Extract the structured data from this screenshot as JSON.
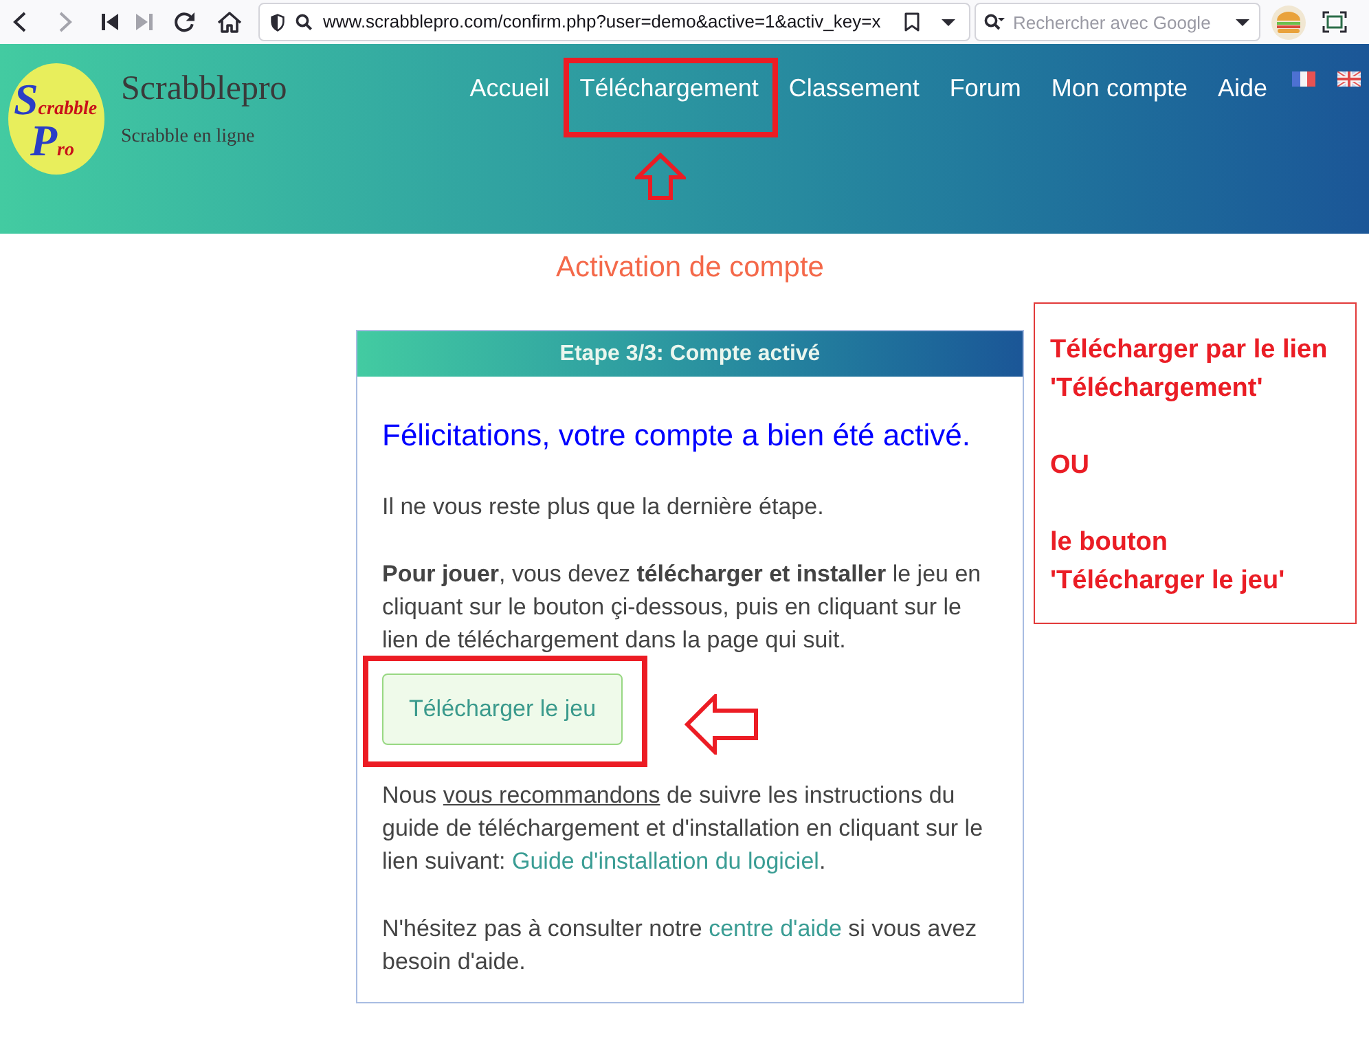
{
  "browser": {
    "nav_buttons": [
      {
        "kind": "back",
        "disabled": false
      },
      {
        "kind": "forward",
        "disabled": true
      },
      {
        "kind": "first",
        "disabled": false
      },
      {
        "kind": "last",
        "disabled": true
      },
      {
        "kind": "reload",
        "disabled": false
      },
      {
        "kind": "home",
        "disabled": false
      }
    ],
    "url": "www.scrabblepro.com/confirm.php?user=demo&active=1&activ_key=x",
    "search_placeholder": "Rechercher avec Google"
  },
  "header": {
    "logo": {
      "lines": [
        {
          "initial": "S",
          "rest": "crabble"
        },
        {
          "initial": "P",
          "rest": "ro"
        }
      ]
    },
    "title": "Scrabblepro",
    "tagline": "Scrabble en ligne",
    "nav": [
      {
        "label": "Accueil",
        "annotated": false
      },
      {
        "label": "Téléchargement",
        "annotated": true
      },
      {
        "label": "Classement",
        "annotated": false
      },
      {
        "label": "Forum",
        "annotated": false
      },
      {
        "label": "Mon compte",
        "annotated": false
      },
      {
        "label": "Aide",
        "annotated": false
      }
    ],
    "languages": [
      {
        "kind": "fr"
      },
      {
        "kind": "en"
      }
    ]
  },
  "page_title": "Activation de compte",
  "card": {
    "header": "Etape 3/3: Compte activé",
    "heading": "Félicitations, votre compte a bien été activé.",
    "blocks": [
      {
        "kind": "paragraph",
        "segments": [
          {
            "kind": "text",
            "text": "Il ne vous reste plus que la dernière étape."
          }
        ]
      },
      {
        "kind": "paragraph",
        "segments": [
          {
            "kind": "text",
            "text": "**Pour jouer**, vous devez **télécharger et installer** le jeu en cliquant sur le bouton çi-dessous, puis en cliquant sur le lien de téléchargement dans la page qui suit."
          }
        ]
      },
      {
        "kind": "button",
        "label": "Télécharger le jeu",
        "annotated": true
      },
      {
        "kind": "paragraph",
        "segments": [
          {
            "kind": "text",
            "text": "Nous "
          },
          {
            "kind": "underline",
            "text": "vous recommandons"
          },
          {
            "kind": "text",
            "text": " de suivre les instructions du guide de téléchargement et d'installation en cliquant sur le lien suivant: "
          },
          {
            "kind": "link",
            "text": "Guide d'installation du logiciel"
          },
          {
            "kind": "text",
            "text": "."
          }
        ]
      },
      {
        "kind": "paragraph",
        "segments": [
          {
            "kind": "text",
            "text": "N'hésitez pas à consulter notre "
          },
          {
            "kind": "link",
            "text": "centre d'aide"
          },
          {
            "kind": "text",
            "text": " si vous avez besoin d'aide."
          }
        ]
      }
    ]
  },
  "callout": {
    "paragraphs": [
      "Télécharger par le lien\n'Téléchargement'",
      "OU",
      "le bouton\n'Télécharger le jeu'"
    ]
  }
}
